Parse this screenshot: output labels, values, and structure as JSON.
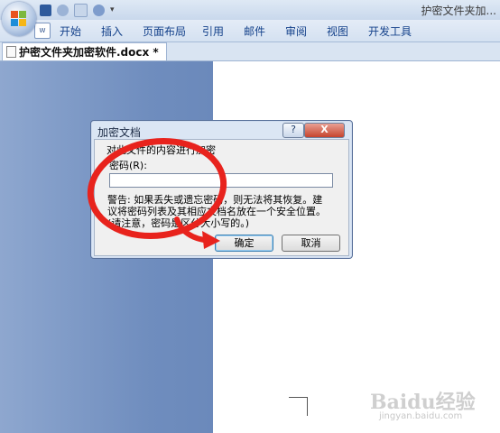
{
  "window": {
    "title": "护密文件夹加..."
  },
  "ribbon": {
    "tabs": [
      "开始",
      "插入",
      "页面布局",
      "引用",
      "邮件",
      "审阅",
      "视图",
      "开发工具"
    ]
  },
  "document_tab": {
    "label": "护密文件夹加密软件.docx *"
  },
  "dialog": {
    "title": "加密文档",
    "help_label": "?",
    "close_label": "X",
    "section_label": "对此文件的内容进行加密",
    "password_label": "密码(R):",
    "password_value": "",
    "warning_line1": "警告: 如果丢失或遗忘密码，则无法将其恢复。建",
    "warning_line2": "议将密码列表及其相应文档名放在一个安全位置。",
    "warning_line3": "(请注意，密码是区分大小写的。)",
    "ok_label": "确定",
    "cancel_label": "取消"
  },
  "watermark": {
    "brand": "Baidu经验",
    "sub": "jingyan.baidu.com"
  },
  "colors": {
    "annotation_red": "#e8231d",
    "accent_blue": "#15428b"
  }
}
